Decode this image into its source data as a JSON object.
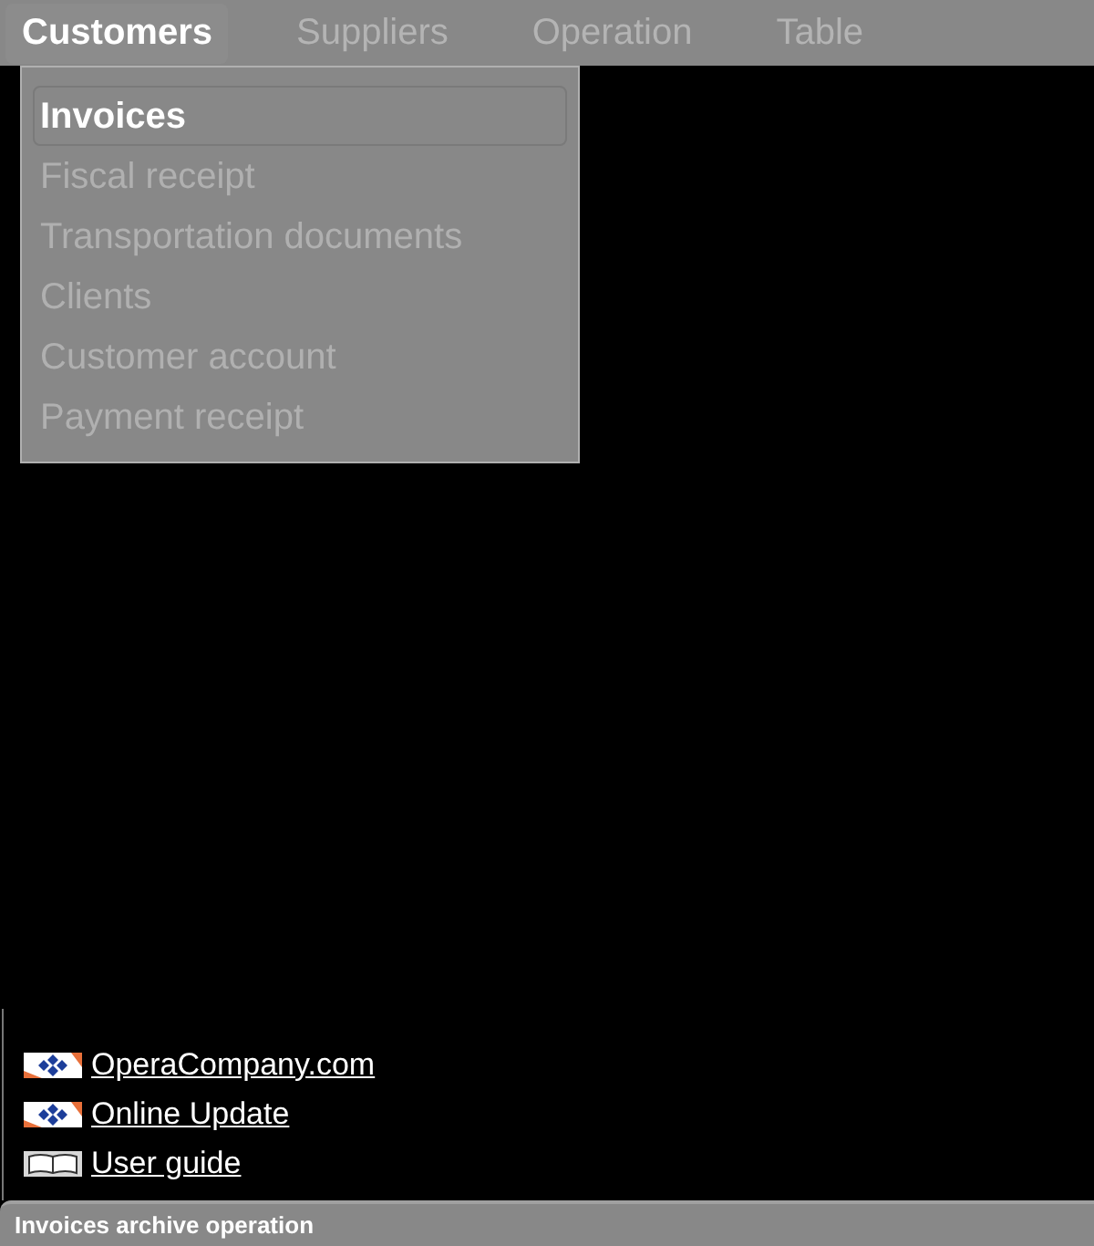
{
  "menu_bar": [
    {
      "label": "Customers",
      "selected": true
    },
    {
      "label": "Suppliers",
      "selected": false
    },
    {
      "label": "Operation",
      "selected": false
    },
    {
      "label": "Table",
      "selected": false
    }
  ],
  "dropdown": [
    {
      "label": "Invoices",
      "selected": true
    },
    {
      "label": "Fiscal receipt",
      "selected": false
    },
    {
      "label": "Transportation documents",
      "selected": false
    },
    {
      "label": "Clients",
      "selected": false
    },
    {
      "label": "Customer account",
      "selected": false
    },
    {
      "label": "Payment receipt",
      "selected": false
    }
  ],
  "links": [
    {
      "label": "OperaCompany.com",
      "kind": "logo"
    },
    {
      "label": "Online Update",
      "kind": "logo"
    },
    {
      "label": "User guide",
      "kind": "book"
    }
  ],
  "status_bar": "Invoices archive operation"
}
